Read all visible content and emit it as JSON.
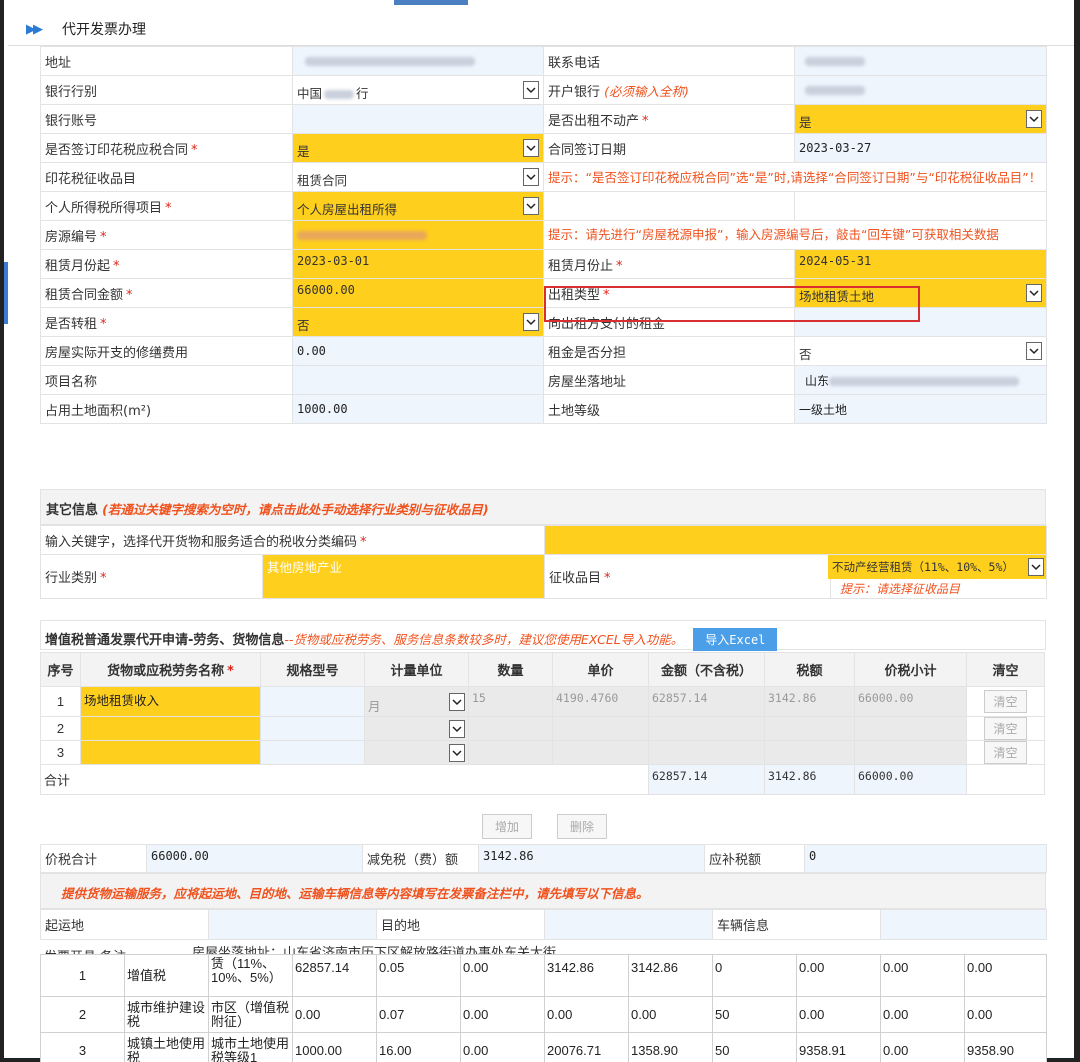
{
  "header": {
    "title": "代开发票办理"
  },
  "form": {
    "address_label": "地址",
    "phone_label": "联系电话",
    "bank_type_label": "银行行别",
    "bank_type_value": "中国",
    "bank_type_suffix": "行",
    "open_bank_label": "开户银行",
    "open_bank_hint": "(必须输入全称)",
    "bank_account_label": "银行账号",
    "is_rent_estate_label": "是否出租不动产",
    "is_rent_estate_value": "是",
    "stamp_contract_label": "是否签订印花税应税合同",
    "stamp_contract_value": "是",
    "contract_date_label": "合同签订日期",
    "contract_date_value": "2023-03-27",
    "stamp_item_label": "印花税征收品目",
    "stamp_item_value": "租赁合同",
    "stamp_tip": "提示：“是否签订印花税应税合同”选“是”时,请选择“合同签订日期”与“印花税征收品目”！",
    "income_item_label": "个人所得税所得项目",
    "income_item_value": "个人房屋出租所得",
    "house_no_label": "房源编号",
    "house_tip": "提示：请先进行“房屋税源申报”，输入房源编号后，敲击“回车键”可获取相关数据",
    "rent_start_label": "租赁月份起",
    "rent_start_value": "2023-03-01",
    "rent_end_label": "租赁月份止",
    "rent_end_value": "2024-05-31",
    "contract_amount_label": "租赁合同金额",
    "contract_amount_value": "66000.00",
    "rent_type_label": "出租类型",
    "rent_type_value": "场地租赁土地",
    "sublet_label": "是否转租",
    "sublet_value": "否",
    "rent_paid_label": "向出租方支付的租金",
    "repair_label": "房屋实际开支的修缮费用",
    "repair_value": "0.00",
    "rent_share_label": "租金是否分担",
    "rent_share_value": "否",
    "project_label": "项目名称",
    "location_label": "房屋坐落地址",
    "location_value": "山东",
    "land_area_label": "占用土地面积(m²)",
    "land_area_value": "1000.00",
    "land_grade_label": "土地等级",
    "land_grade_value": "一级土地"
  },
  "other": {
    "title": "其它信息",
    "hint": "(若通过关键字搜索为空时，请点击此处手动选择行业类别与征收品目)",
    "keyword_label": "输入关键字，选择代开货物和服务适合的税收分类编码",
    "industry_label": "行业类别",
    "industry_value": "其他房地产业",
    "levy_label": "征收品目",
    "levy_value": "不动产经营租赁（11%、10%、5%）",
    "levy_tip": "提示：请选择征收品目"
  },
  "goods": {
    "title": "增值税普通发票代开申请-劳务、货物信息",
    "hint": "--货物或应税劳务、服务信息条数较多时，建议您使用EXCEL导入功能。",
    "import_btn": "导入Excel",
    "headers": [
      "序号",
      "货物或应税劳务名称",
      "规格型号",
      "计量单位",
      "数量",
      "单价",
      "金额（不含税）",
      "税额",
      "价税小计",
      "清空"
    ],
    "rows": [
      {
        "no": "1",
        "name": "场地租赁收入",
        "unit": "月",
        "qty": "15",
        "price": "4190.4760",
        "amount": "62857.14",
        "tax": "3142.86",
        "total": "66000.00",
        "clear": "清空"
      },
      {
        "no": "2",
        "clear": "清空"
      },
      {
        "no": "3",
        "clear": "清空"
      }
    ],
    "total_label": "合计",
    "total_amount": "62857.14",
    "total_tax": "3142.86",
    "total_sum": "66000.00",
    "add_btn": "增加",
    "delete_btn": "删除"
  },
  "summary": {
    "total_label": "价税合计",
    "total_value": "66000.00",
    "relief_label": "减免税（费）额",
    "relief_value": "3142.86",
    "supp_label": "应补税额",
    "supp_value": "0"
  },
  "transport": {
    "notice": "提供货物运输服务，应将起运地、目的地、运输车辆信息等内容填写在发票备注栏中，请先填写以下信息。",
    "origin_label": "起运地",
    "dest_label": "目的地",
    "vehicle_label": "车辆信息"
  },
  "remark": {
    "label": "发票开具 备注",
    "value": "房屋坐落地址：山东省济南市历下区解放路街道办事处东关大街"
  },
  "tax_rows": [
    [
      "1",
      "增值税",
      "赁（11%、10%、5%）",
      "62857.14",
      "0.05",
      "0.00",
      "3142.86",
      "3142.86",
      "0",
      "0.00",
      "0.00",
      "0.00"
    ],
    [
      "2",
      "城市维护建设税",
      "市区（增值税附征）",
      "0.00",
      "0.07",
      "0.00",
      "0.00",
      "0.00",
      "50",
      "0.00",
      "0.00",
      "0.00"
    ],
    [
      "3",
      "城镇土地使用税",
      "城市土地使用税等级1",
      "1000.00",
      "16.00",
      "0.00",
      "20076.71",
      "1358.90",
      "50",
      "9358.91",
      "0.00",
      "9358.90"
    ]
  ],
  "colors": {
    "yellow": "#fecf1d",
    "light_blue": "#eef5fd",
    "red_hint": "#f0521e",
    "accent": "#4a9fe8"
  }
}
